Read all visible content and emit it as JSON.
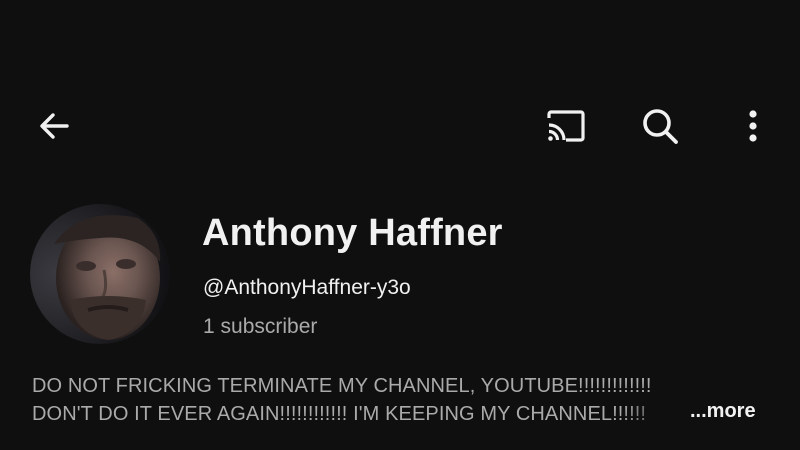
{
  "header": {
    "back_icon": "arrow-left-icon",
    "cast_icon": "cast-icon",
    "search_icon": "search-icon",
    "more_icon": "more-vert-icon"
  },
  "channel": {
    "name": "Anthony Haffner",
    "handle": "@AnthonyHaffner-y3o",
    "subscribers": "1 subscriber",
    "description_line1": "DO NOT FRICKING TERMINATE MY CHANNEL, YOUTUBE!!!!!!!!!!!!!",
    "description_line2": "DON'T DO IT EVER AGAIN!!!!!!!!!!!! I'M KEEPING MY CHANNEL!!!!!!",
    "more_label": "...more"
  },
  "colors": {
    "background": "#0f0f0f",
    "primary_text": "#f1f1f1",
    "secondary_text": "#aaaaaa"
  }
}
